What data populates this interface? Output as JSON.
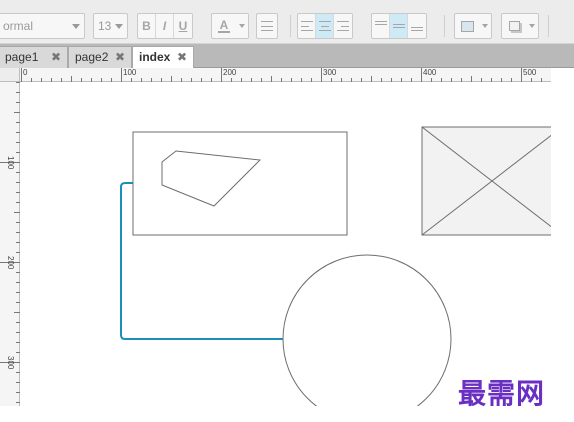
{
  "toolbar": {
    "style_dropdown": "ormal",
    "font_size_dropdown": "13",
    "text_buttons": [
      "B",
      "I",
      "U"
    ],
    "font_color_button": "A"
  },
  "tabs": [
    {
      "label": "page1",
      "active": false
    },
    {
      "label": "page2",
      "active": false
    },
    {
      "label": "index",
      "active": true
    }
  ],
  "ruler": {
    "horizontal_labels": [
      "0",
      "100",
      "200",
      "300",
      "400",
      "500"
    ],
    "vertical_labels": [
      "100",
      "200",
      "300"
    ]
  },
  "canvas": {
    "connector_color": "#1a8fb8",
    "placeholder_fill": "#f2f2f2"
  },
  "watermark": "最需网",
  "colors": {
    "accent": "#1a8fb8",
    "active_button": "#cfeaf7",
    "watermark": "#6a2fc2"
  }
}
